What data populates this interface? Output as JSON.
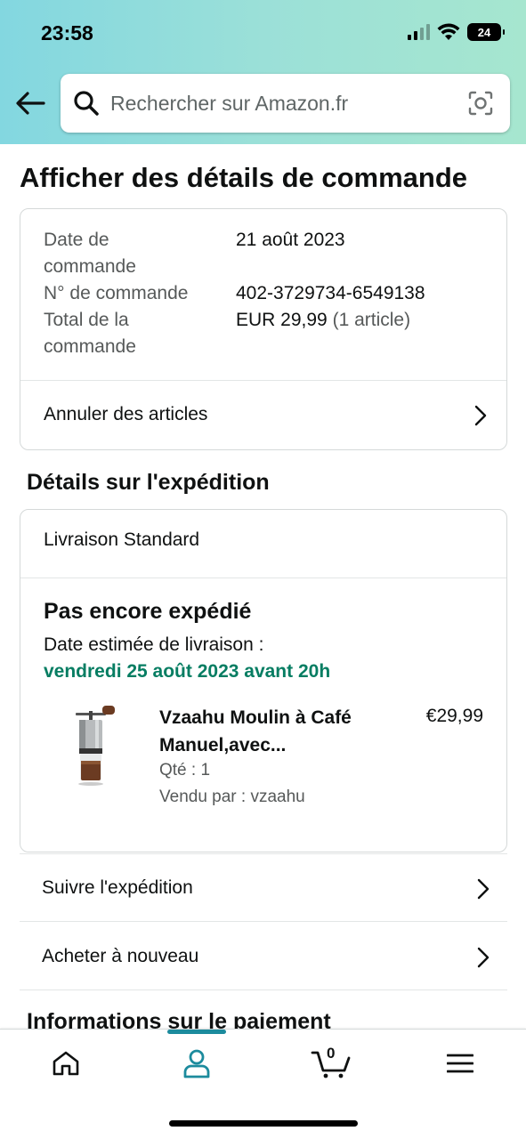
{
  "status_bar": {
    "time": "23:58",
    "battery": "24"
  },
  "search": {
    "placeholder": "Rechercher sur Amazon.fr"
  },
  "page": {
    "title": "Afficher des détails de commande"
  },
  "order_summary": {
    "date_label": "Date de commande",
    "date_value": "21 août 2023",
    "number_label": "N° de commande",
    "number_value": "402-3729734-6549138",
    "total_label": "Total de la commande",
    "total_value": "EUR 29,99",
    "total_items": "(1 article)",
    "cancel_link": "Annuler des articles"
  },
  "shipping": {
    "section_title": "Détails sur l'expédition",
    "method": "Livraison Standard",
    "status": "Pas encore expédié",
    "delivery_label": "Date estimée de livraison :",
    "delivery_date": "vendredi 25 août 2023 avant 20h",
    "product": {
      "title": "Vzaahu Moulin à Café Manuel,avec...",
      "price": "€29,99",
      "qty": "Qté : 1",
      "seller": "Vendu par : vzaahu"
    }
  },
  "actions": {
    "track": "Suivre l'expédition",
    "buy_again": "Acheter à nouveau"
  },
  "payment": {
    "section_title": "Informations sur le paiement"
  },
  "tabbar": {
    "cart_count": "0",
    "active_tab": "profile"
  },
  "colors": {
    "header_gradient_start": "#83d7e0",
    "header_gradient_end": "#a6e6cf",
    "delivery_green": "#067d62",
    "tab_accent": "#1c8b9d"
  },
  "icons": [
    "back-arrow-icon",
    "search-icon",
    "camera-icon",
    "chevron-right-icon",
    "home-icon",
    "profile-icon",
    "cart-icon",
    "menu-icon"
  ]
}
